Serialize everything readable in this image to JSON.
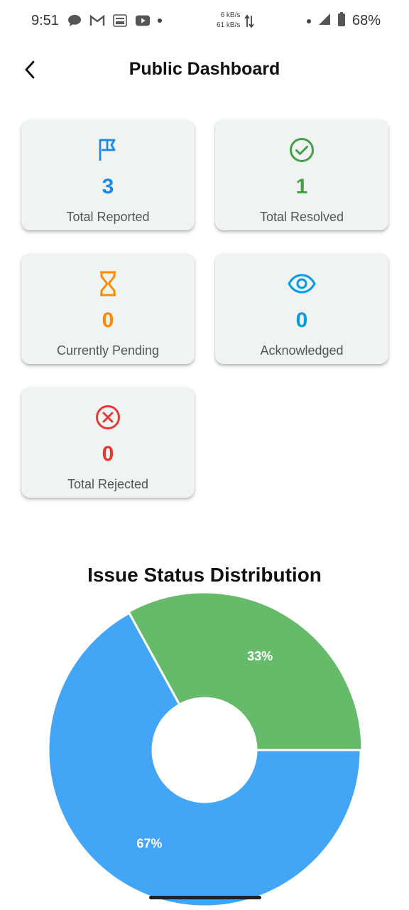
{
  "status_bar": {
    "time": "9:51",
    "speed_up": "6 kB/s",
    "speed_down": "61 kB/s",
    "battery": "68%",
    "notification_icons": [
      "chat-bubble-icon",
      "gmail-icon",
      "tata-1mg-icon",
      "youtube-icon"
    ]
  },
  "header": {
    "title": "Public Dashboard"
  },
  "cards": [
    {
      "label": "Total Reported",
      "value": "3",
      "icon": "flag-icon",
      "color": "#1e88e5"
    },
    {
      "label": "Total Resolved",
      "value": "1",
      "icon": "check-circle-icon",
      "color": "#43a047"
    },
    {
      "label": "Currently Pending",
      "value": "0",
      "icon": "hourglass-icon",
      "color": "#fb8c00"
    },
    {
      "label": "Acknowledged",
      "value": "0",
      "icon": "eye-icon",
      "color": "#039be5"
    },
    {
      "label": "Total Rejected",
      "value": "0",
      "icon": "cancel-circle-icon",
      "color": "#e53935"
    }
  ],
  "chart_title": "Issue Status Distribution",
  "chart_data": {
    "type": "pie",
    "title": "Issue Status Distribution",
    "slices": [
      {
        "label": "67%",
        "value": 67,
        "color": "#42a5f5"
      },
      {
        "label": "33%",
        "value": 33,
        "color": "#66bb6a"
      }
    ]
  }
}
